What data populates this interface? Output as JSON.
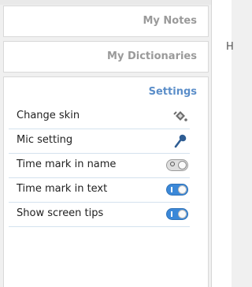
{
  "tabs": {
    "my_notes": "My Notes",
    "my_dictionaries": "My Dictionaries"
  },
  "settings": {
    "title": "Settings",
    "items": [
      {
        "label": "Change skin",
        "icon": "paint-bucket-icon"
      },
      {
        "label": "Mic setting",
        "icon": "microphone-icon"
      },
      {
        "label": "Time mark in name",
        "toggle": "off"
      },
      {
        "label": "Time mark in text",
        "toggle": "on"
      },
      {
        "label": "Show screen tips",
        "toggle": "on"
      }
    ]
  },
  "page": {
    "edge_text": "H"
  },
  "colors": {
    "accent": "#5b8ec9",
    "toggle_on": "#3b88d8",
    "divider": "#d4e2ee"
  }
}
